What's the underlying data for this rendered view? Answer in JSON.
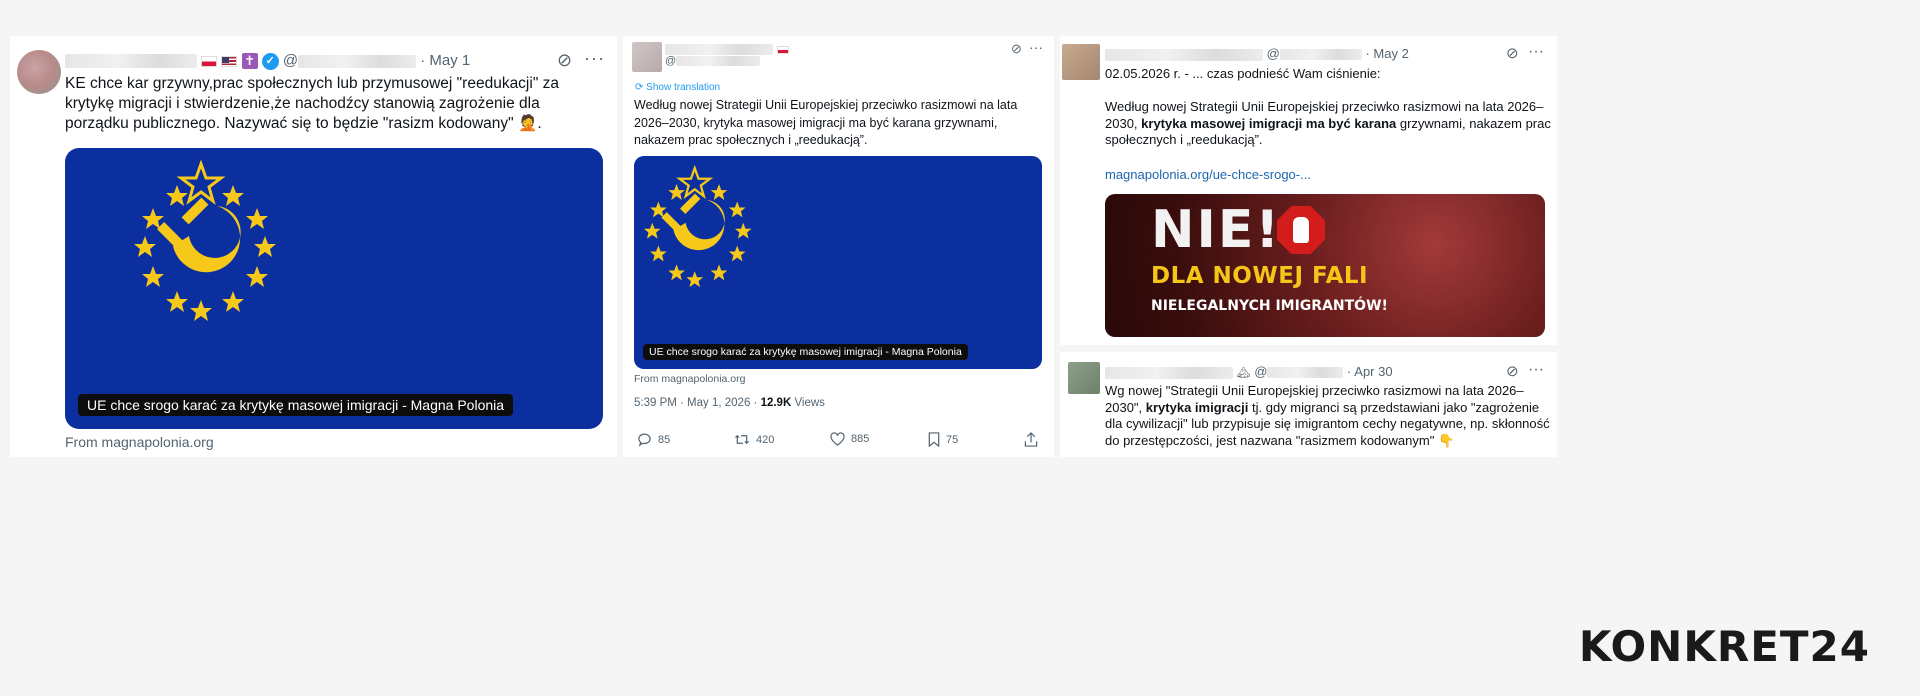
{
  "colors": {
    "eu_blue": "#0b2f9f",
    "star_yellow": "#f6c81a",
    "link": "#1d66b0",
    "muted": "#536471"
  },
  "tweet1": {
    "handle_prefix": "@",
    "date": "· May 1",
    "text": "KE chce kar grzywny,prac społecznych  lub przymusowej \"reedukacji\" za krytykę migracji i stwierdzenie,że nachodźcy stanowią zagrożenie dla porządku publicznego. Nazywać się to będzie \"rasizm kodowany\"",
    "emoji": "🤦",
    "caption": "UE chce srogo karać za krytykę masowej imigracji - Magna Polonia",
    "from": "From magnapolonia.org"
  },
  "tweet2": {
    "handle_prefix": "@",
    "show_translation": "Show translation",
    "text": "Według nowej Strategii Unii Europejskiej przeciwko rasizmowi na lata 2026–2030, krytyka masowej imigracji ma być karana grzywnami, nakazem prac społecznych i „reedukacją”.",
    "caption": "UE chce srogo karać za krytykę masowej imigracji - Magna Polonia",
    "from": "From magnapolonia.org",
    "timestamp": "5:39 PM · May 1, 2026 · ",
    "views_count": "12.9K",
    "views_label": " Views",
    "replies": "85",
    "reposts": "420",
    "likes": "885",
    "bookmarks": "75"
  },
  "tweet3": {
    "handle_prefix": "@",
    "date": "· May 2",
    "line1": "02.05.2026 r. - ... czas podnieść Wam ciśnienie:",
    "text_a": "Według nowej Strategii Unii Europejskiej przeciwko rasizmowi na lata 2026–2030, ",
    "text_bold": "krytyka masowej imigracji ma być karana",
    "text_b": " grzywnami, nakazem prac społecznych i „reedukacją”.",
    "link": "magnapolonia.org/ue-chce-srogo-...",
    "banner_nie": "NIE!",
    "banner_line2": "DLA NOWEJ FALI",
    "banner_line3": "NIELEGALNYCH IMIGRANTÓW!"
  },
  "tweet4": {
    "handle_prefix": "@",
    "date": "· Apr 30",
    "text_a": "Wg nowej \"Strategii Unii Europejskiej przeciwko rasizmowi na lata 2026–2030\", ",
    "text_bold": "krytyka imigracji",
    "text_b": " tj. gdy migranci są przedstawiani jako \"zagrożenie dla cywilizacji\" lub przypisuje się imigrantom cechy negatywne, np. skłonność do przestępczości, jest nazwana \"rasizmem kodowanym\"",
    "emoji": "👇"
  },
  "brand": {
    "logo": "KONKRET24"
  }
}
